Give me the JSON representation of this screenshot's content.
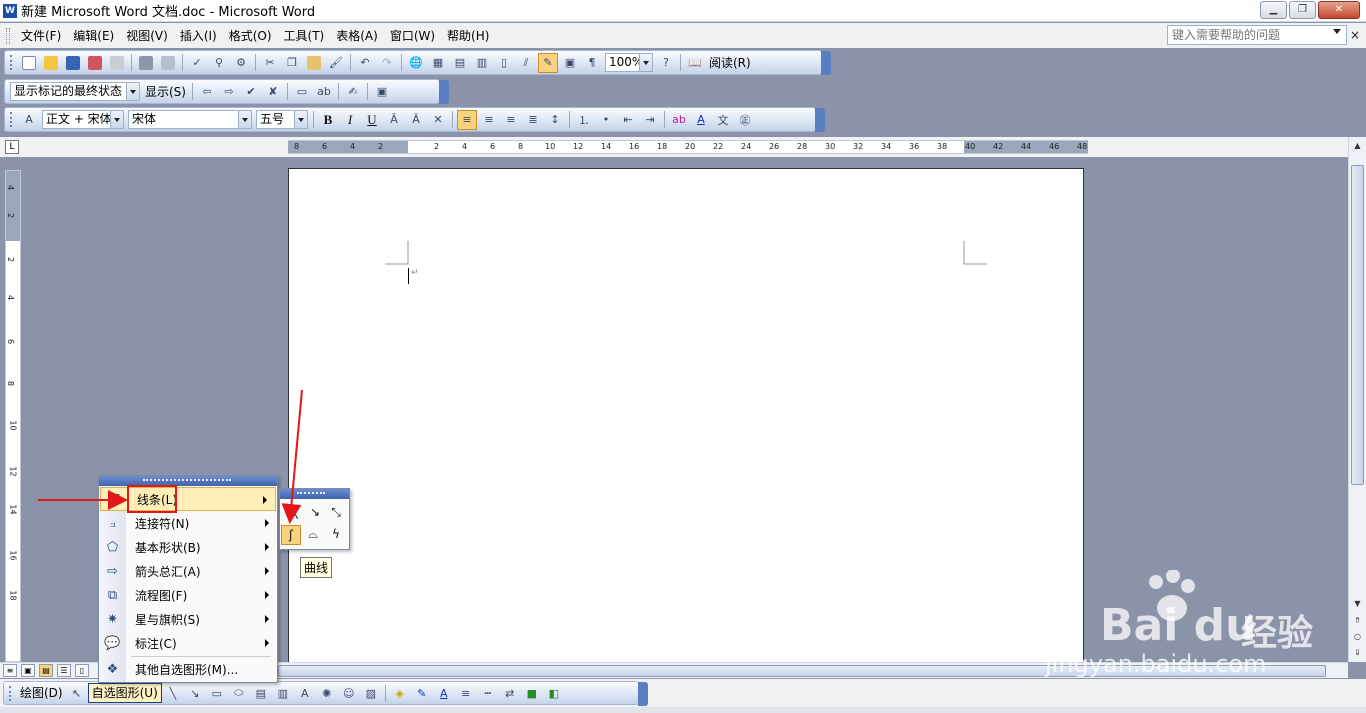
{
  "window": {
    "title": "新建 Microsoft Word 文档.doc - Microsoft Word",
    "minimize": "▁",
    "restore": "❐",
    "close": "✕"
  },
  "menubar": {
    "items": [
      "文件(F)",
      "编辑(E)",
      "视图(V)",
      "插入(I)",
      "格式(O)",
      "工具(T)",
      "表格(A)",
      "窗口(W)",
      "帮助(H)"
    ],
    "help_placeholder": "键入需要帮助的问题",
    "doc_close": "×"
  },
  "standard_toolbar": {
    "zoom": "100%",
    "read_label": "阅读(R)"
  },
  "reviewing_toolbar": {
    "markup_view": "显示标记的最终状态",
    "show_label": "显示(S)"
  },
  "formatting_toolbar": {
    "style": "正文 + 宋体",
    "font": "宋体",
    "size": "五号",
    "bold": "B",
    "italic": "I",
    "underline": "U"
  },
  "ruler": {
    "corner": "L",
    "h_numbers": [
      "8",
      "6",
      "4",
      "2",
      "2",
      "4",
      "6",
      "8",
      "10",
      "12",
      "14",
      "16",
      "18",
      "20",
      "22",
      "24",
      "26",
      "28",
      "30",
      "32",
      "34",
      "36",
      "38",
      "40",
      "42",
      "44",
      "46",
      "48"
    ],
    "v_numbers": [
      "4",
      "2",
      "2",
      "4",
      "6",
      "8",
      "10",
      "12",
      "14",
      "16",
      "18"
    ]
  },
  "drawing_toolbar": {
    "draw_label": "绘图(D)",
    "autoshapes_label": "自选图形(U)"
  },
  "autoshapes_menu": {
    "items": [
      {
        "label": "线条(L)",
        "icon": "lines-icon",
        "glyph": "⤢",
        "has_sub": true,
        "highlighted": true
      },
      {
        "label": "连接符(N)",
        "icon": "connector-icon",
        "glyph": "⟓",
        "has_sub": true
      },
      {
        "label": "基本形状(B)",
        "icon": "basic-shapes-icon",
        "glyph": "⬠",
        "has_sub": true
      },
      {
        "label": "箭头总汇(A)",
        "icon": "block-arrows-icon",
        "glyph": "⇨",
        "has_sub": true
      },
      {
        "label": "流程图(F)",
        "icon": "flowchart-icon",
        "glyph": "⧉",
        "has_sub": true
      },
      {
        "label": "星与旗帜(S)",
        "icon": "stars-banners-icon",
        "glyph": "✷",
        "has_sub": true
      },
      {
        "label": "标注(C)",
        "icon": "callout-icon",
        "glyph": "💬",
        "has_sub": true
      },
      {
        "label": "其他自选图形(M)...",
        "icon": "more-shapes-icon",
        "glyph": "❖",
        "has_sub": false
      }
    ]
  },
  "lines_submenu": {
    "tooltip": "曲线",
    "buttons": [
      {
        "name": "line-icon",
        "glyph": "╲"
      },
      {
        "name": "arrow-line-icon",
        "glyph": "↘"
      },
      {
        "name": "double-arrow-line-icon",
        "glyph": "⤡"
      },
      {
        "name": "curve-icon",
        "glyph": "ʃ",
        "selected": true
      },
      {
        "name": "freeform-icon",
        "glyph": "⌓"
      },
      {
        "name": "scribble-icon",
        "glyph": "ϟ"
      }
    ]
  },
  "watermark": {
    "brand": "Bai du",
    "cn": "经验",
    "url": "jingyan.baidu.com"
  },
  "colors": {
    "annotation_red": "#e3161a",
    "toolbar_blue": "#5a7ec2",
    "highlight": "#ffeeb8"
  }
}
